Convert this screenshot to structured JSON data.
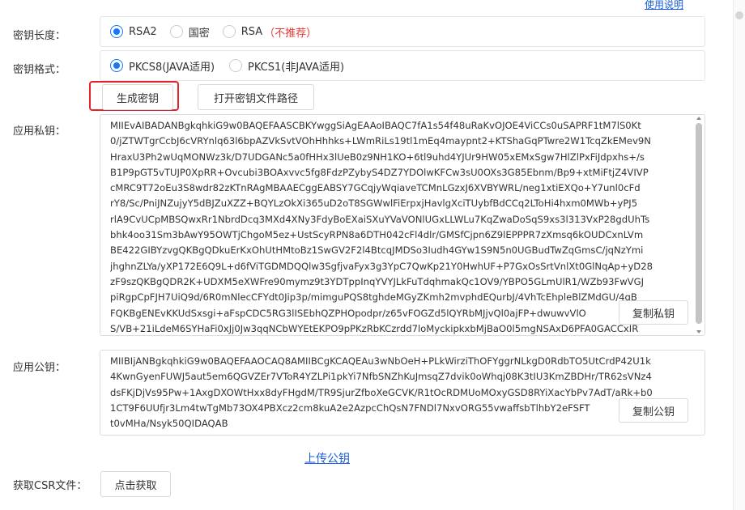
{
  "header": {
    "usage_link": "使用说明"
  },
  "key_length": {
    "label": "密钥长度：",
    "options": [
      {
        "label": "RSA2",
        "selected": true
      },
      {
        "label": "国密",
        "selected": false
      },
      {
        "label": "RSA",
        "selected": false,
        "note": "（不推荐）"
      }
    ]
  },
  "key_format": {
    "label": "密钥格式：",
    "options": [
      {
        "label": "PKCS8(JAVA适用)",
        "selected": true
      },
      {
        "label": "PKCS1(非JAVA适用)",
        "selected": false
      }
    ]
  },
  "actions": {
    "generate_label": "生成密钥",
    "open_path_label": "打开密钥文件路径"
  },
  "private_key": {
    "label": "应用私钥：",
    "copy_label": "复制私钥",
    "lines": [
      "MIIEvAIBADANBgkqhkiG9w0BAQEFAASCBKYwggSiAgEAAoIBAQC7fA1s54f48uRaKvOJOE4ViCCs0uSAPRF1tM7lS0Kt",
      "0/jZTWTgrCcbJ6cVRYnlq63l6bpAZVkSvtVOhHhhks+LWmRiLs19tl1mEq4maypnt2+KTShaGqPTwre2W1TcqZkEMev9N",
      "HraxU3Ph2wUqMONWz3k/D7UDGANc5a0fHHx3lUeB0z9NH1KO+6tl9uhd4YJUr9HW05xEMxSgw7HlZlPxFiJdpxhs+/s",
      "B1P9pGT5vTUJP0XpRR+Ovcubi3BOAxvvc5fg8FdzPZybyS4DZ7YDOlwKFCw3sU0OXs3G85Ebnm/Bp9+xtMiFtjZ4VIVP",
      "cMRC9T72oEu3S8wdr82zKTnRAgMBAAECggEABSY7GCqjyWqiaveTCMnLGzxJ6XVBYWRL/neg1xtiEXQo+Y7unl0cFd",
      "rY8/Sc/PniJNZujyY5dBJZuXZZ+BQYLzOkXi365uD2oT8SGWwlFiErpxjHavlgXciTUybfBdCCq2LToHi4hxm0MWb+yPJ5",
      "rlA9CvUCpMBSQwxRr1NbrdDcq3MXd4XNy3FdyBoEXaiSXuYVaVONlUGxLLWLu7KqZwaDoSqS9xs3l313VxP28gdUhTs",
      "bhk4oo31Sm3bAwY95OWTjChgoM5ez+UstScyRPN8a6DTH042cFl4dlr/GMSfCjpn6Z9lEPPPR7zXmsq6kOUDCxnLVm",
      "BE422GIBYzvgQKBgQDkuErKxOhUtHMtoBz1SwGV2F2l4BtcqJMDSo3Iudh4GYw1S9N5n0UGBudTwZqGmsC/jqNzYmi",
      "jhghnZLYa/yXP172E6Q9L+d6fViTGDMDQQlw3SgfjvaFyx3g3YpC7QwKp21Y0HwhUF+P7GxOsSrtVnlXt0GlNqAp+yD28",
      "zF9szQKBgQDR2K+UDXM5eXWFre90mymz9t3YDTppInqYVYJLkFuTdqhmakQc1OV9/YBPO5GLmUlR1/WZb93FwVGJ",
      "piRgpCpFJH7UiQ9d/6R0mNlecCFYdt0Jip3p/mimguPQS8tghdeMGyZKmh2mvphdEQurbJ/4VhTcEhpleBlZMdGU/4qB",
      "FQKBgENEvKKUdSxsgi+aFspCDC5RG3lISEbhQZPHOpodpr/z65vFOGZd5lQYRbMJjvQl0ajFP+dwuwvVlO",
      "S/VB+21iLdeM6SYHaFi0xJj0Jw3qqNCbWYEtEKPO9pPKzRbKCzrdd7loMyckipkxbMjBaO0l5mgNSAxD6PFA0GACCxIR"
    ]
  },
  "public_key": {
    "label": "应用公钥：",
    "copy_label": "复制公钥",
    "lines": [
      "MIIBIjANBgkqhkiG9w0BAQEFAAOCAQ8AMIIBCgKCAQEAu3wNbOeH+PLkWirziThOFYggrNLkgD0RdbTO5UtCrdP42U1k",
      "4KwnGyenFUWJ5aut5em6QGVZEr7VToR4YZLPi1pkYi7NfbSNZhKuJmsqZ7dvik0oWhqj08K3tIU3KmZBDHr/TR62sVNz4",
      "dsFKjDjVs95Pw+1AxgDXOWtHxx8dyFHgdM/TR9SjurZfboXeGCVK/R1tOcRDMUoMOxyGSD8RYiXacYbPv7AdT/aRk+b0",
      "1CT9F6UUfjr3Lm4twTgMb73OX4PBXcz2cm8kuA2e2AzpcChQsN7FNDl7NxvORG55vwaffsbTlhbY2eFSFT",
      "t0vMHa/Nsyk50QIDAQAB"
    ]
  },
  "upload_link": "上传公钥",
  "csr": {
    "label": "获取CSR文件：",
    "button_label": "点击获取"
  }
}
